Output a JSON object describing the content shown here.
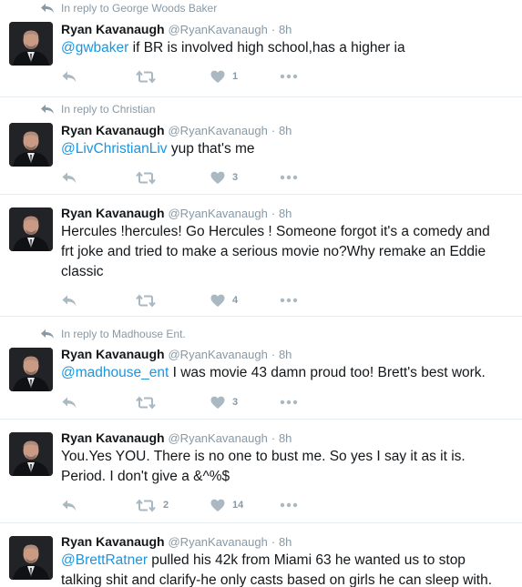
{
  "tweets": [
    {
      "reply_to": "In reply to George Woods Baker",
      "name": "Ryan Kavanaugh",
      "handle": "@RyanKavanaugh",
      "dot": "·",
      "time": "8h",
      "mention": "@gwbaker",
      "text": " if BR is involved high school,has a higher ia",
      "retweets": "",
      "likes": "1"
    },
    {
      "reply_to": "In reply to Christian",
      "name": "Ryan Kavanaugh",
      "handle": "@RyanKavanaugh",
      "dot": "·",
      "time": "8h",
      "mention": "@LivChristianLiv",
      "text": " yup that's me",
      "retweets": "",
      "likes": "3"
    },
    {
      "reply_to": "",
      "name": "Ryan Kavanaugh",
      "handle": "@RyanKavanaugh",
      "dot": "·",
      "time": "8h",
      "mention": "",
      "text": "Hercules !hercules! Go Hercules ! Someone forgot it's a comedy and\nfrt joke and tried to make a serious movie no?Why remake an Eddie\nclassic",
      "retweets": "",
      "likes": "4"
    },
    {
      "reply_to": "In reply to Madhouse Ent.",
      "name": "Ryan Kavanaugh",
      "handle": "@RyanKavanaugh",
      "dot": "·",
      "time": "8h",
      "mention": "@madhouse_ent",
      "text": " I was movie 43 damn proud too! Brett's best work.",
      "retweets": "",
      "likes": "3"
    },
    {
      "reply_to": "",
      "name": "Ryan Kavanaugh",
      "handle": "@RyanKavanaugh",
      "dot": "·",
      "time": "8h",
      "mention": "",
      "text": "You.Yes YOU. There is no one to bust me. So yes I say it as it is.\nPeriod. I don't give a &^%$",
      "retweets": "2",
      "likes": "14"
    },
    {
      "reply_to": "",
      "name": "Ryan Kavanaugh",
      "handle": "@RyanKavanaugh",
      "dot": "·",
      "time": "8h",
      "mention": "@BrettRatner",
      "text": " pulled his 42k from Miami 63 he wanted us to stop\ntalking shit and clarify-he only casts based on girls he can sleep with.",
      "retweets": "",
      "likes": ""
    }
  ],
  "icons": {
    "reply": "reply-icon",
    "retweet": "retweet-icon",
    "like": "heart-icon",
    "more": "more-dots-icon"
  },
  "colors": {
    "mention": "#1b95e0",
    "meta": "#8899a6",
    "icon": "#aab8c2",
    "divider": "#e6ecf0"
  }
}
